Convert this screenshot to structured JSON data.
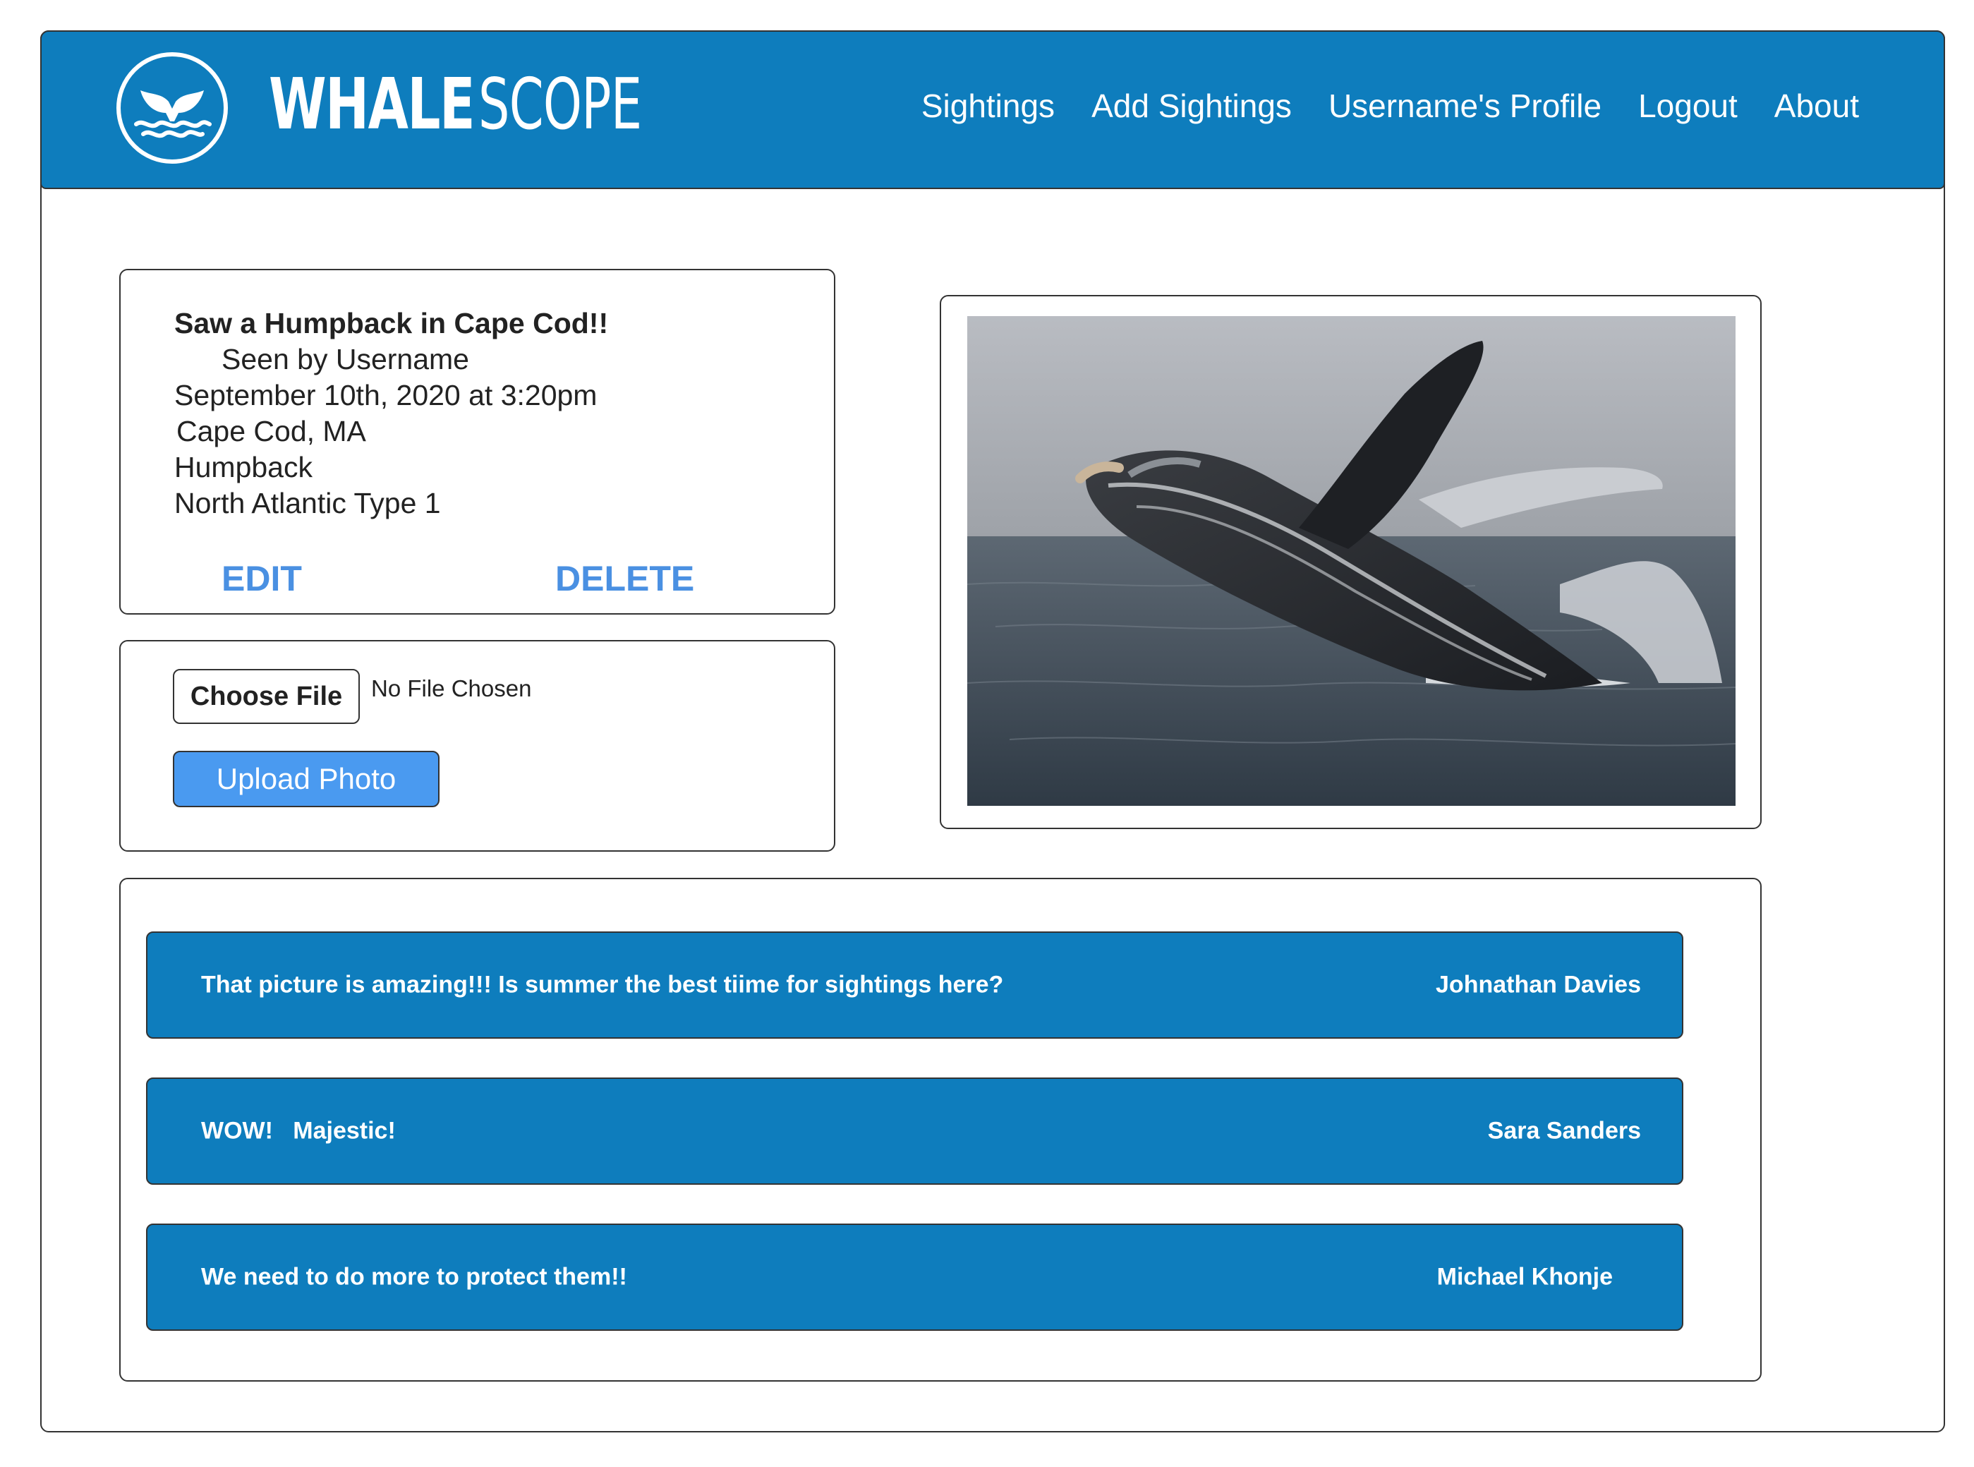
{
  "header": {
    "brand_bold": "WHALE",
    "brand_light": "SCOPE",
    "nav": [
      "Sightings",
      "Add Sightings",
      "Username's Profile",
      "Logout",
      "About"
    ],
    "color": "#0e7dbd"
  },
  "sighting": {
    "title": "Saw a Humpback in Cape Cod!!",
    "seen_by": "Seen by Username",
    "datetime": "September 10th, 2020 at 3:20pm",
    "location": "Cape Cod, MA",
    "species": "Humpback",
    "population": "North Atlantic Type 1",
    "edit_label": "EDIT",
    "delete_label": "DELETE",
    "action_color": "#4a90e2"
  },
  "upload": {
    "choose_label": "Choose File",
    "file_status": "No File Chosen",
    "upload_label": "Upload Photo",
    "upload_color": "#4a9af0"
  },
  "photo": {
    "icon": "whale-breach-photo"
  },
  "comments": [
    {
      "text": "That picture is amazing!!! Is summer the best tiime for sightings here?",
      "author": "Johnathan Davies"
    },
    {
      "text": "WOW!   Majestic!",
      "author": "Sara Sanders"
    },
    {
      "text": "We need to do more to protect them!!",
      "author": "Michael Khonje"
    }
  ]
}
